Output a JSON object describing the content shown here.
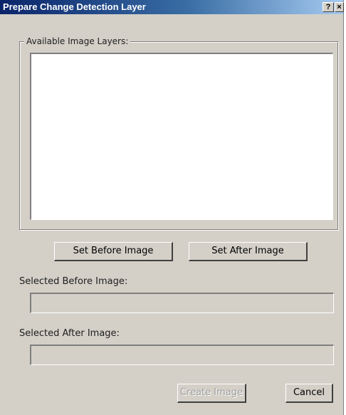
{
  "window": {
    "title": "Prepare Change Detection Layer",
    "help_button": "?",
    "close_button": "×"
  },
  "layers_group": {
    "label": "Available Image Layers:",
    "items": []
  },
  "actions": {
    "set_before_label": "Set Before Image",
    "set_after_label": "Set After Image",
    "create_label": "Create Image",
    "create_enabled": false,
    "cancel_label": "Cancel"
  },
  "selected_before": {
    "label": "Selected Before Image:",
    "value": ""
  },
  "selected_after": {
    "label": "Selected After Image:",
    "value": ""
  },
  "colors": {
    "titlebar_start": "#0a246a",
    "titlebar_end": "#a6caf0",
    "dialog_background": "#d4d0c8",
    "disabled_text": "#a0a0a0"
  }
}
